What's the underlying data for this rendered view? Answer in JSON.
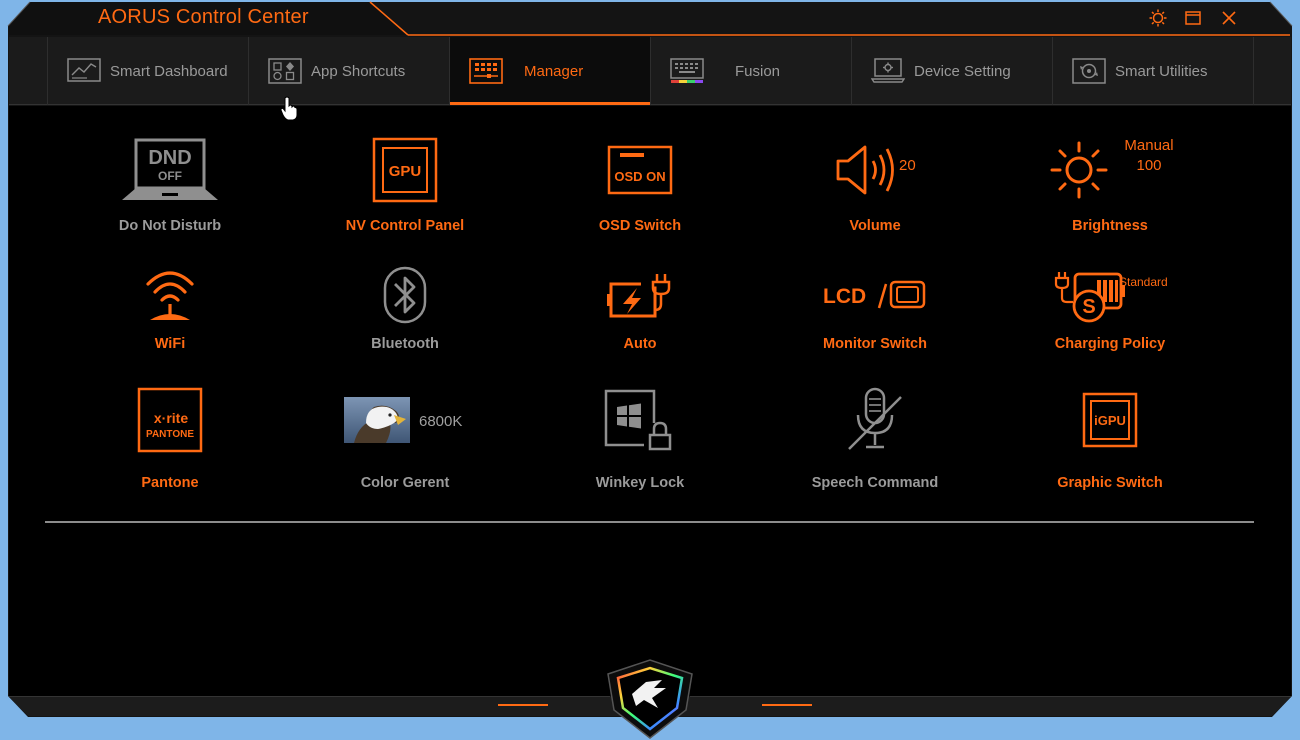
{
  "window": {
    "title": "AORUS Control Center",
    "buttons": {
      "settings": "gear-icon",
      "maximize": "maximize-icon",
      "close": "close-icon"
    }
  },
  "tabs": [
    {
      "label": "Smart Dashboard",
      "icon": "dashboard-icon"
    },
    {
      "label": "App Shortcuts",
      "icon": "app-grid-icon"
    },
    {
      "label": "Manager",
      "icon": "manager-icon",
      "active": true
    },
    {
      "label": "Fusion",
      "icon": "keyboard-rgb-icon"
    },
    {
      "label": "Device Setting",
      "icon": "laptop-gear-icon"
    },
    {
      "label": "Smart Utilities",
      "icon": "utilities-icon"
    }
  ],
  "manager": {
    "dnd": {
      "label": "Do Not Disturb",
      "icon_top": "DND",
      "icon_bottom": "OFF"
    },
    "nv": {
      "label": "NV Control Panel",
      "icon_text": "GPU"
    },
    "osd": {
      "label": "OSD Switch",
      "icon_text": "OSD ON"
    },
    "volume": {
      "label": "Volume",
      "value": "20"
    },
    "brightness": {
      "label": "Brightness",
      "mode": "Manual",
      "value": "100"
    },
    "wifi": {
      "label": "WiFi"
    },
    "bluetooth": {
      "label": "Bluetooth"
    },
    "power": {
      "label": "Auto"
    },
    "monitor": {
      "label": "Monitor Switch",
      "icon_text": "LCD"
    },
    "charging": {
      "label": "Charging Policy",
      "value": "Standard",
      "icon_letter": "S"
    },
    "pantone": {
      "label": "Pantone",
      "brand_line1": "x·rite",
      "brand_line2": "PANTONE"
    },
    "color": {
      "label": "Color Gerent",
      "value": "6800K"
    },
    "winkey": {
      "label": "Winkey Lock"
    },
    "speech": {
      "label": "Speech Command"
    },
    "graphic": {
      "label": "Graphic Switch",
      "icon_text": "iGPU"
    }
  },
  "colors": {
    "accent": "#ff6a13",
    "inactive": "#9b9b9b",
    "background": "#000000",
    "desktop": "#7fb5e8"
  }
}
